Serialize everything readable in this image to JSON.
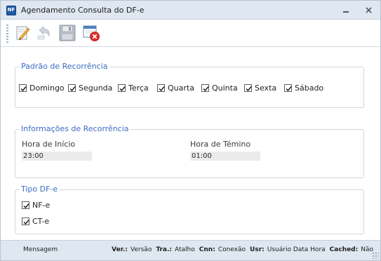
{
  "window": {
    "title": "Agendamento Consulta do DF-e",
    "icon_text": "NF"
  },
  "toolbar": {
    "items": [
      {
        "name": "edit",
        "icon": "pencil-edit-icon"
      },
      {
        "name": "undo",
        "icon": "undo-arrow-icon"
      },
      {
        "name": "save",
        "icon": "floppy-save-icon"
      },
      {
        "name": "cancel",
        "icon": "window-close-icon"
      }
    ]
  },
  "recurrence_pattern": {
    "legend": "Padrão de Recorrência",
    "days": [
      {
        "label": "Domingo",
        "checked": true
      },
      {
        "label": "Segunda",
        "checked": true
      },
      {
        "label": "Terça",
        "checked": true
      },
      {
        "label": "Quarta",
        "checked": true
      },
      {
        "label": "Quinta",
        "checked": true
      },
      {
        "label": "Sexta",
        "checked": true
      },
      {
        "label": "Sábado",
        "checked": true
      }
    ]
  },
  "recurrence_info": {
    "legend": "Informações de Recorrência",
    "start_label": "Hora de Início",
    "start_value": "23:00",
    "end_label": "Hora de Témino",
    "end_value": "01:00"
  },
  "dfe_type": {
    "legend": "Tipo DF-e",
    "options": [
      {
        "label": "NF-e",
        "checked": true
      },
      {
        "label": "CT-e",
        "checked": true
      }
    ]
  },
  "statusbar": {
    "message": "Mensagem",
    "ver_key": "Ver.:",
    "ver_val": "Versão",
    "tra_key": "Tra.:",
    "tra_val": "Atalho",
    "cnn_key": "Cnn:",
    "cnn_val": "Conexão",
    "usr_key": "Usr:",
    "usr_val": "Usuário Data Hora",
    "cached_key": "Cached:",
    "cached_val": "Não"
  },
  "colors": {
    "accent": "#3b6cc3",
    "titlebar": "#dfe7f0",
    "close_red": "#e02a2a"
  }
}
